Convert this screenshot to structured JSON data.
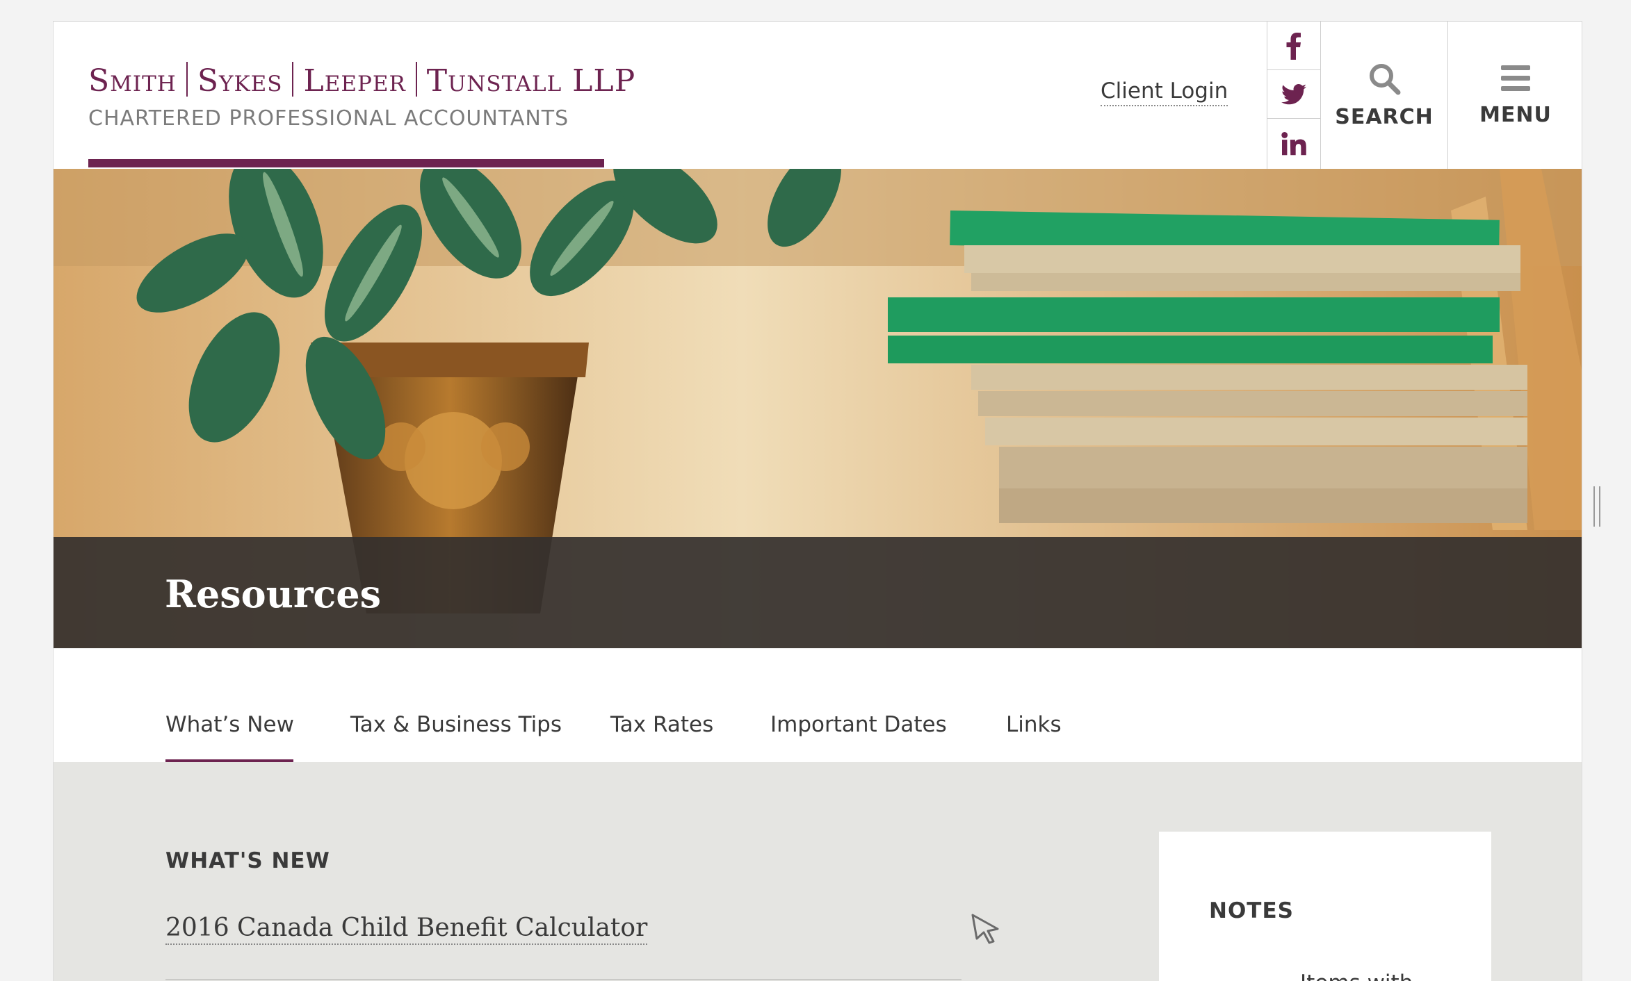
{
  "brand": {
    "line1_parts": [
      "Smith",
      "Sykes",
      "Leeper",
      "Tunstall LLP"
    ],
    "line2": "CHARTERED PROFESSIONAL ACCOUNTANTS",
    "accent_color": "#6d2350"
  },
  "header": {
    "client_login": "Client Login",
    "social": [
      {
        "name": "facebook-icon",
        "glyph": "f"
      },
      {
        "name": "twitter-icon",
        "glyph": "bird"
      },
      {
        "name": "linkedin-icon",
        "glyph": "in"
      }
    ],
    "search_label": "SEARCH",
    "menu_label": "MENU"
  },
  "hero": {
    "title": "Resources"
  },
  "tabs": {
    "items": [
      {
        "label": "What’s New",
        "active": true
      },
      {
        "label": "Tax & Business Tips",
        "active": false
      },
      {
        "label": "Tax Rates",
        "active": false
      },
      {
        "label": "Important Dates",
        "active": false
      },
      {
        "label": "Links",
        "active": false
      }
    ]
  },
  "main": {
    "section_heading": "WHAT'S NEW",
    "articles": [
      {
        "title": "2016 Canada Child Benefit Calculator"
      }
    ]
  },
  "notes": {
    "title": "NOTES",
    "text": "Items with"
  }
}
